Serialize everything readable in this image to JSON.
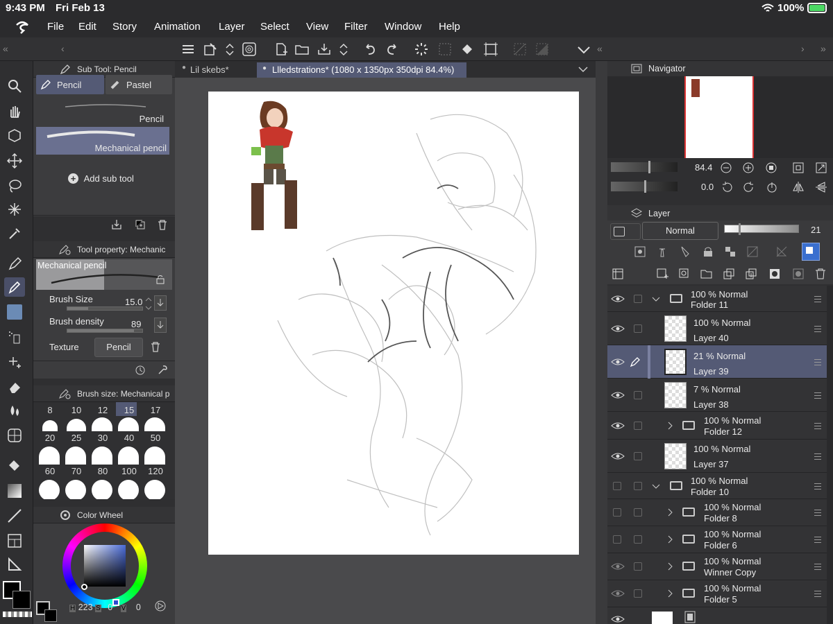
{
  "status": {
    "time": "9:43 PM",
    "date": "Fri Feb 13",
    "battery": "100%"
  },
  "menu": [
    "File",
    "Edit",
    "Story",
    "Animation",
    "Layer",
    "Select",
    "View",
    "Filter",
    "Window",
    "Help"
  ],
  "subtool": {
    "header": "Sub Tool: Pencil",
    "tab_pencil": "Pencil",
    "tab_pastel": "Pastel",
    "items": [
      "Pencil",
      "Mechanical pencil"
    ],
    "add": "Add sub tool"
  },
  "toolprop": {
    "header": "Tool property: Mechanic",
    "preview_label": "Mechanical pencil",
    "brush_size_label": "Brush Size",
    "brush_size_value": "15.0",
    "brush_density_label": "Brush density",
    "brush_density_value": "89",
    "texture_label": "Texture",
    "texture_value": "Pencil"
  },
  "brushsize": {
    "header": "Brush size: Mechanical p",
    "sizes_row1": [
      "8",
      "10",
      "12",
      "15",
      "17"
    ],
    "sizes_row2": [
      "20",
      "25",
      "30",
      "40",
      "50"
    ],
    "sizes_row3": [
      "60",
      "70",
      "80",
      "100",
      "120"
    ],
    "selected": "15"
  },
  "colorwheel": {
    "header": "Color Wheel",
    "h_label": "H",
    "h_value": "223",
    "s_label": "S",
    "s_value": "0",
    "v_label": "V",
    "v_value": "0"
  },
  "doctabs": [
    "Lil skebs*",
    "Llledstrations* (1080 x 1350px 350dpi 84.4%)"
  ],
  "navigator": {
    "header": "Navigator",
    "zoom": "84.4",
    "rotation": "0.0"
  },
  "layerpanel": {
    "header": "Layer",
    "blend_mode": "Normal",
    "opacity": "21"
  },
  "layers": [
    {
      "mode": "100 %  Normal",
      "name": "Folder 11"
    },
    {
      "mode": "100 %  Normal",
      "name": "Layer 40"
    },
    {
      "mode": "21 %  Normal",
      "name": "Layer 39"
    },
    {
      "mode": "7 %  Normal",
      "name": "Layer 38"
    },
    {
      "mode": "100 %  Normal",
      "name": "Folder 12"
    },
    {
      "mode": "100 %  Normal",
      "name": "Layer 37"
    },
    {
      "mode": "100 %  Normal",
      "name": "Folder 10"
    },
    {
      "mode": "100 %  Normal",
      "name": "Folder 8"
    },
    {
      "mode": "100 %  Normal",
      "name": "Folder 6"
    },
    {
      "mode": "100 %  Normal",
      "name": "Winner Copy"
    },
    {
      "mode": "100 %  Normal",
      "name": "Folder 5"
    }
  ],
  "colors": {
    "accent": "#545a75",
    "panel": "#3c3c3e",
    "battery": "#4cd964"
  }
}
